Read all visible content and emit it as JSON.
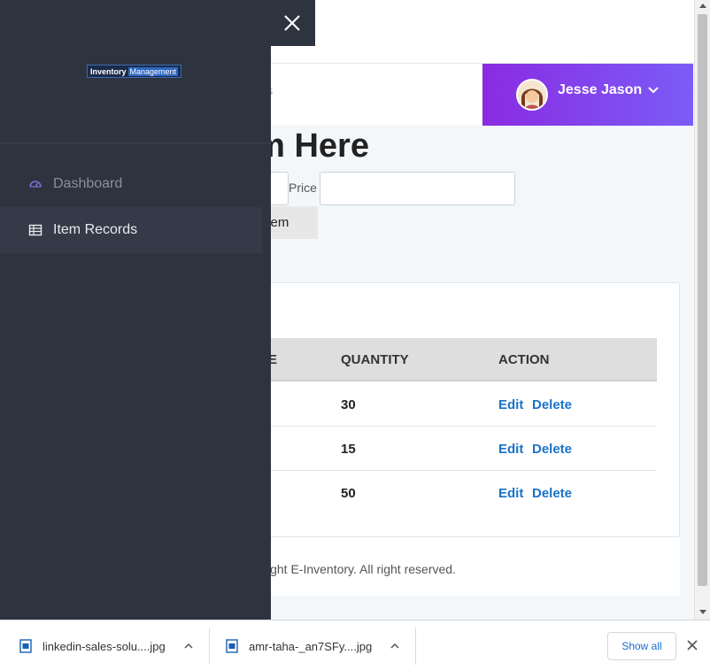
{
  "header": {
    "nav_text": "s",
    "user_name": "Jesse Jason"
  },
  "form": {
    "title": "d Item Here",
    "price_label": "Price",
    "add_button_label": "item"
  },
  "table": {
    "headers": [
      "E",
      "QUANTITY",
      "ACTION"
    ],
    "rows": [
      {
        "quantity": "30",
        "edit": "Edit",
        "delete": "Delete"
      },
      {
        "quantity": "15",
        "edit": "Edit",
        "delete": "Delete"
      },
      {
        "quantity": "50",
        "edit": "Edit",
        "delete": "Delete"
      }
    ]
  },
  "footer": {
    "text": "ight E-Inventory. All right reserved."
  },
  "drawer": {
    "brand_part1": "Inventory",
    "brand_part2": "Management",
    "menu": [
      {
        "label": "Dashboard",
        "icon": "speedometer-icon"
      },
      {
        "label": "Item Records",
        "icon": "table-icon"
      }
    ]
  },
  "downloads": {
    "items": [
      {
        "name": "linkedin-sales-solu....jpg"
      },
      {
        "name": "amr-taha-_an7SFy....jpg"
      }
    ],
    "show_all_label": "Show all"
  },
  "colors": {
    "drawer_bg": "#2e3340",
    "user_gradient_start": "#8a2be2",
    "user_gradient_end": "#7b5cf6",
    "link": "#1a73c8"
  }
}
